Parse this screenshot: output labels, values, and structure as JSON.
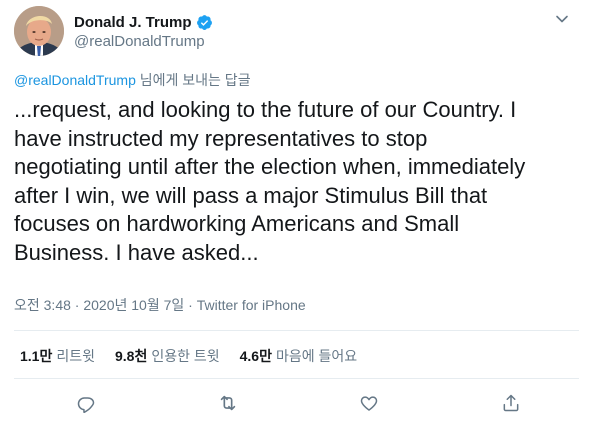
{
  "tweet": {
    "author": {
      "display_name": "Donald J. Trump",
      "handle": "@realDonaldTrump",
      "verified": true,
      "avatar_icon": "profile-avatar"
    },
    "reply_to": {
      "mention": "@realDonaldTrump",
      "suffix": " 님에게 보내는 답글"
    },
    "text": "...request, and looking to the future of our Country. I\nhave instructed my representatives to stop\nnegotiating until after the election when, immediately\nafter I win, we will pass a major Stimulus Bill that\nfocuses on hardworking Americans and Small\nBusiness. I have asked...",
    "meta": "오전 3:48 · 2020년 10월 7일 · Twitter for iPhone",
    "stats": {
      "retweets": {
        "count": "1.1만",
        "label": "리트윗"
      },
      "quotes": {
        "count": "9.8천",
        "label": "인용한 트윗"
      },
      "likes": {
        "count": "4.6만",
        "label": "마음에 들어요"
      }
    },
    "actions": {
      "reply_icon": "reply-icon",
      "retweet_icon": "retweet-icon",
      "like_icon": "like-icon",
      "share_icon": "share-icon",
      "more_icon": "chevron-down-icon"
    },
    "colors": {
      "text": "#14171a",
      "secondary": "#657786",
      "link": "#1b95e0",
      "verified": "#1da1f2",
      "divider": "#e6ecf0"
    }
  }
}
